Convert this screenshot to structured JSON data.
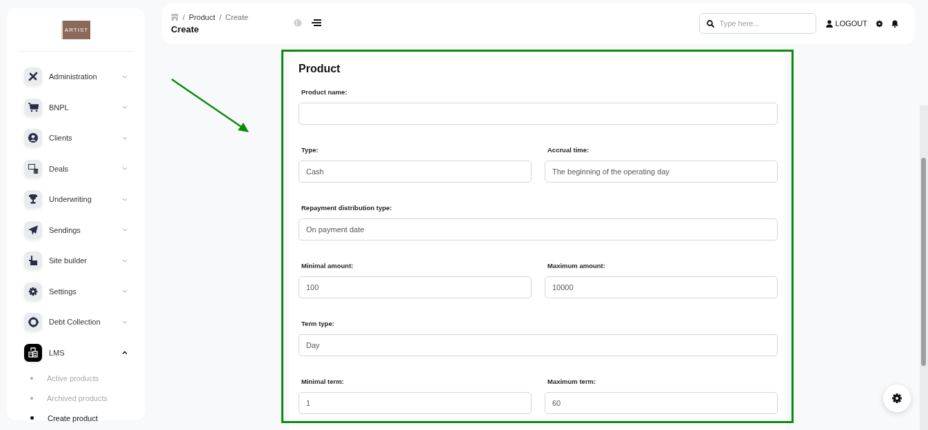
{
  "sidebar": {
    "logo": "ARTIST",
    "items": [
      {
        "label": "Administration",
        "expanded": false
      },
      {
        "label": "BNPL",
        "expanded": false
      },
      {
        "label": "Clients",
        "expanded": false
      },
      {
        "label": "Deals",
        "expanded": false
      },
      {
        "label": "Underwriting",
        "expanded": false
      },
      {
        "label": "Sendings",
        "expanded": false
      },
      {
        "label": "Site builder",
        "expanded": false
      },
      {
        "label": "Settings",
        "expanded": false
      },
      {
        "label": "Debt Collection",
        "expanded": false
      },
      {
        "label": "LMS",
        "expanded": true,
        "children": [
          {
            "label": "Active products",
            "selected": false
          },
          {
            "label": "Archived products",
            "selected": false
          },
          {
            "label": "Create product",
            "selected": true
          }
        ]
      }
    ]
  },
  "header": {
    "breadcrumb": [
      {
        "separator": "/",
        "label": "Product"
      },
      {
        "separator": "/",
        "label": "Create"
      }
    ],
    "title": "Create",
    "search": {
      "placeholder": "Type here..."
    },
    "logout": "LOGOUT"
  },
  "form": {
    "title": "Product",
    "rows": [
      [
        {
          "label": "Product name:"
        }
      ],
      [
        {
          "label": "Type:",
          "value": "Cash"
        },
        {
          "label": "Accrual time:",
          "value": "The beginning of the operating day"
        }
      ],
      [
        {
          "label": "Repayment distribution type:",
          "value": "On payment date"
        }
      ],
      [
        {
          "label": "Minimal amount:",
          "value": "100"
        },
        {
          "label": "Maximum amount:",
          "value": "10000"
        }
      ],
      [
        {
          "label": "Term type:",
          "value": "Day"
        }
      ],
      [
        {
          "label": "Minimal term:",
          "value": "1"
        },
        {
          "label": "Maximum term:",
          "value": "60"
        }
      ]
    ]
  }
}
